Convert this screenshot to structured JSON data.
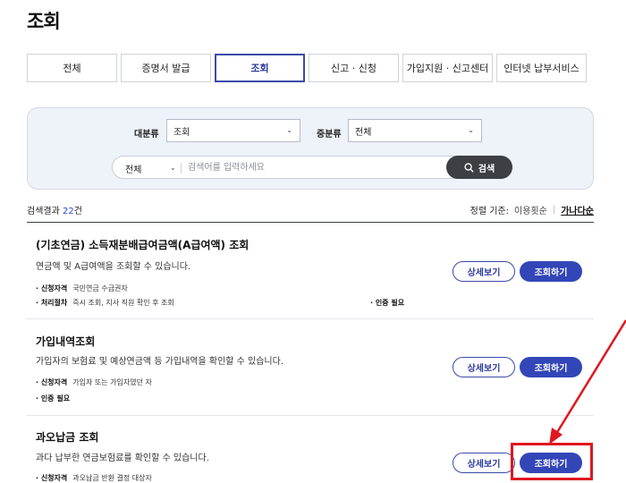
{
  "page": {
    "title": "조회"
  },
  "tabs": [
    {
      "label": "전체"
    },
    {
      "label": "증명서 발급"
    },
    {
      "label": "조회"
    },
    {
      "label": "신고 · 신청"
    },
    {
      "label": "가입지원 · 신고센터"
    },
    {
      "label": "인터넷 납부서비스"
    }
  ],
  "search": {
    "major_label": "대분류",
    "major_value": "조회",
    "minor_label": "중분류",
    "minor_value": "전체",
    "scope_value": "전체",
    "placeholder": "검색어를 입력하세요",
    "button_label": "검색"
  },
  "results": {
    "prefix": "검색결과",
    "count": "22",
    "suffix": "건",
    "sort_label": "정렬 기준:",
    "sort_popular": "이용횟순",
    "sort_alpha": "가나다순"
  },
  "items": [
    {
      "title": "(기초연금) 소득재분배급여금액(A급여액) 조회",
      "desc": "연금액 및 A급여액을 조회할 수 있습니다.",
      "meta1_label": "· 신청자격",
      "meta1_value": "국민연금 수급권자",
      "meta2_label": "· 처리절차",
      "meta2_value": "즉시 조회, 지사 직원 확인 후 조회",
      "meta3_label": "· 인증 필요",
      "detail_label": "상세보기",
      "view_label": "조회하기"
    },
    {
      "title": "가입내역조회",
      "desc": "가입자의 보험료 및 예상연금액 등 가입내역을 확인할 수 있습니다.",
      "meta1_label": "· 신청자격",
      "meta1_value": "가입자 또는 가입자였던 자",
      "meta2_label": "· 인증 필요",
      "detail_label": "상세보기",
      "view_label": "조회하기"
    },
    {
      "title": "과오납금 조회",
      "desc": "과다 납부한 연금보험료를 확인할 수 있습니다.",
      "meta1_label": "· 신청자격",
      "meta1_value": "과오납금 반환 결정 대상자",
      "detail_label": "상세보기",
      "view_label": "조회하기"
    }
  ],
  "colors": {
    "accent": "#3346b8",
    "highlight": "#e0161e"
  }
}
